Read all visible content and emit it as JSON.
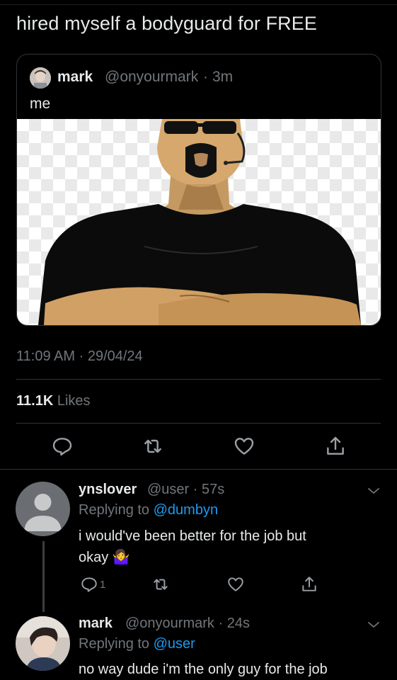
{
  "tweet": {
    "text": "hired myself a bodyguard for FREE",
    "time": "11:09 AM",
    "separator": "·",
    "date": "29/04/24",
    "likes_count": "11.1K",
    "likes_label": "Likes"
  },
  "quoted": {
    "name": "mark",
    "handle": "@onyourmark",
    "dot": "·",
    "time": "3m",
    "text": "me"
  },
  "replies": [
    {
      "name": "ynslover",
      "handle": "@user",
      "time_sep": "·",
      "time": "57s",
      "replying_prefix": "Replying to",
      "replying_to": "@dumbyn",
      "text_line1": "i would've been better for the job but",
      "text_line2": "okay",
      "emoji": "🤷‍♀️",
      "reply_count": "1"
    },
    {
      "name": "mark",
      "handle": "@onyourmark",
      "time_sep": "·",
      "time": "24s",
      "replying_prefix": "Replying to",
      "replying_to": "@user",
      "text_line1": "no way dude i'm the only guy for the job"
    }
  ],
  "icons": {
    "reply": "reply-icon",
    "retweet": "retweet-icon",
    "like": "heart-icon",
    "share": "share-icon",
    "more": "chevron-down-icon"
  },
  "colors": {
    "background": "#000000",
    "text": "#e7e9ea",
    "secondary": "#71767b",
    "link": "#1d9bf0",
    "divider": "#2f3336"
  }
}
